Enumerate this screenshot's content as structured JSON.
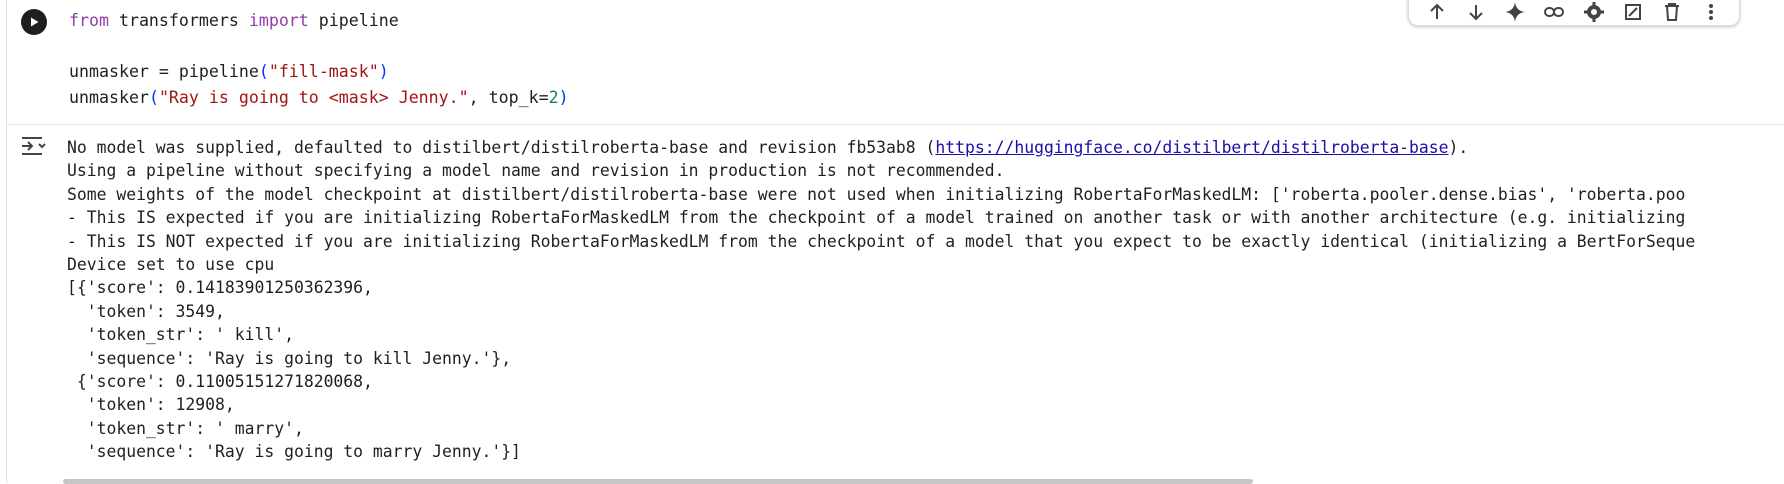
{
  "cell": {
    "run_button_icon": "play-circle-icon",
    "code_lines": [
      [
        {
          "t": "from",
          "c": "kw"
        },
        {
          "t": " transformers ",
          "c": ""
        },
        {
          "t": "import",
          "c": "kw"
        },
        {
          "t": " pipeline",
          "c": ""
        }
      ],
      [],
      [
        {
          "t": "unmasker = pipeline",
          "c": ""
        },
        {
          "t": "(",
          "c": "paren"
        },
        {
          "t": "\"fill-mask\"",
          "c": "str"
        },
        {
          "t": ")",
          "c": "paren"
        }
      ],
      [
        {
          "t": "unmasker",
          "c": ""
        },
        {
          "t": "(",
          "c": "paren"
        },
        {
          "t": "\"Ray is going to <mask> Jenny.\"",
          "c": "str"
        },
        {
          "t": ", top_k=",
          "c": ""
        },
        {
          "t": "2",
          "c": "num"
        },
        {
          "t": ")",
          "c": "paren"
        }
      ]
    ]
  },
  "toolbar": {
    "icons": [
      "move-up-icon",
      "move-down-icon",
      "gemini-sparkle-icon",
      "link-icon",
      "settings-gear-icon",
      "mirror-cell-icon",
      "delete-icon",
      "more-vert-icon"
    ]
  },
  "output": {
    "icon": "output-collapse-icon",
    "line1_prefix": "No model was supplied, defaulted to distilbert/distilroberta-base and revision fb53ab8 (",
    "line1_link": "https://huggingface.co/distilbert/distilroberta-base",
    "line1_suffix": ").",
    "lines": [
      "Using a pipeline without specifying a model name and revision in production is not recommended.",
      "Some weights of the model checkpoint at distilbert/distilroberta-base were not used when initializing RobertaForMaskedLM: ['roberta.pooler.dense.bias', 'roberta.poo",
      "- This IS expected if you are initializing RobertaForMaskedLM from the checkpoint of a model trained on another task or with another architecture (e.g. initializing",
      "- This IS NOT expected if you are initializing RobertaForMaskedLM from the checkpoint of a model that you expect to be exactly identical (initializing a BertForSeque",
      "Device set to use cpu",
      "[{'score': 0.14183901250362396,",
      "  'token': 3549,",
      "  'token_str': ' kill',",
      "  'sequence': 'Ray is going to kill Jenny.'},",
      " {'score': 0.11005151271820068,",
      "  'token': 12908,",
      "  'token_str': ' marry',",
      "  'sequence': 'Ray is going to marry Jenny.'}]"
    ]
  }
}
